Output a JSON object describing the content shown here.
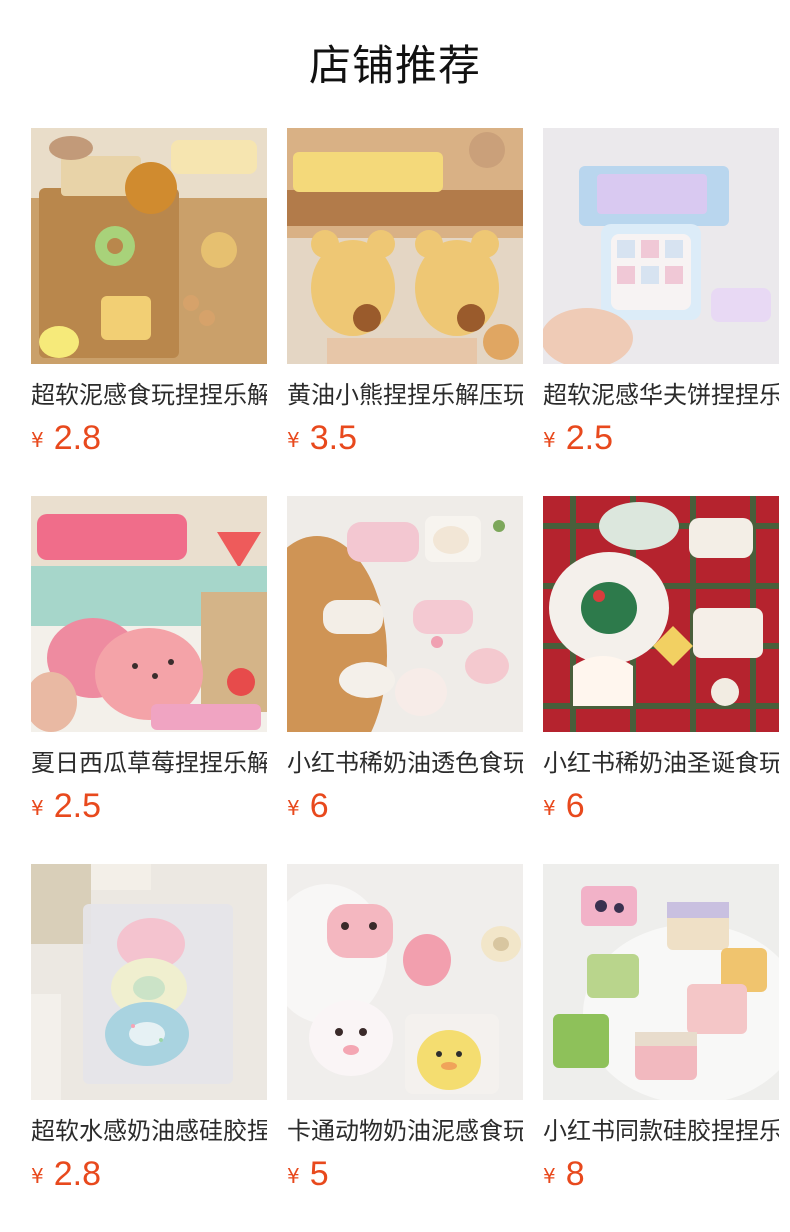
{
  "page": {
    "title": "店铺推荐"
  },
  "theme": {
    "price_color": "#e8491d",
    "title_color": "#111111"
  },
  "products": [
    {
      "name": "超软泥感食玩捏捏乐解压",
      "currency": "¥",
      "price": "2.8",
      "image": "product-photo"
    },
    {
      "name": "黄油小熊捏捏乐解压玩具",
      "currency": "¥",
      "price": "3.5",
      "image": "product-photo"
    },
    {
      "name": "超软泥感华夫饼捏捏乐",
      "currency": "¥",
      "price": "2.5",
      "image": "product-photo"
    },
    {
      "name": "夏日西瓜草莓捏捏乐解压",
      "currency": "¥",
      "price": "2.5",
      "image": "product-photo"
    },
    {
      "name": "小红书稀奶油透色食玩",
      "currency": "¥",
      "price": "6",
      "image": "product-photo"
    },
    {
      "name": "小红书稀奶油圣诞食玩",
      "currency": "¥",
      "price": "6",
      "image": "product-photo"
    },
    {
      "name": "超软水感奶油感硅胶捏捏",
      "currency": "¥",
      "price": "2.8",
      "image": "product-photo"
    },
    {
      "name": "卡通动物奶油泥感食玩",
      "currency": "¥",
      "price": "5",
      "image": "product-photo"
    },
    {
      "name": "小红书同款硅胶捏捏乐",
      "currency": "¥",
      "price": "8",
      "image": "product-photo"
    }
  ]
}
